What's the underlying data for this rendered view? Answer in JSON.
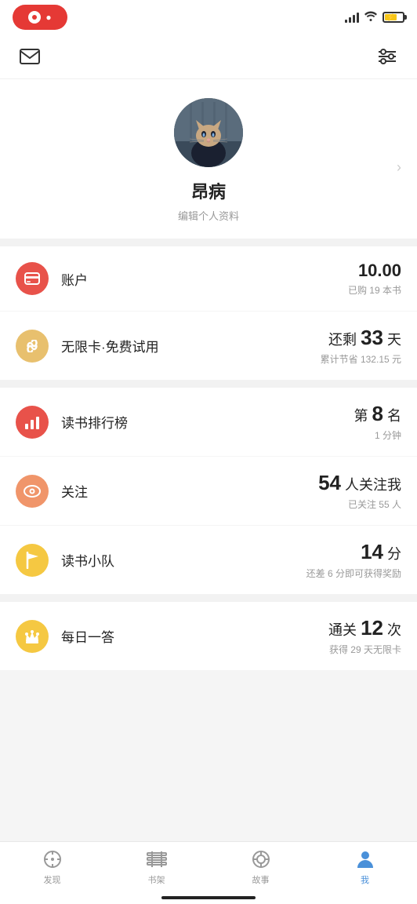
{
  "statusBar": {
    "recordLabel": "REC"
  },
  "topNav": {
    "mailIcon": "✉",
    "settingsIcon": "⚙"
  },
  "profile": {
    "username": "昂病",
    "editLabel": "编辑个人资料"
  },
  "menuItems": [
    {
      "id": "account",
      "iconBg": "#e8524a",
      "iconColor": "#fff",
      "iconSymbol": "account",
      "label": "账户",
      "mainValue": "10.00",
      "subValue": "已购 19 本书"
    },
    {
      "id": "unlimited",
      "iconBg": "#e8c06e",
      "iconColor": "#fff",
      "iconSymbol": "infinite",
      "label": "无限卡·免费试用",
      "mainPrefix": "还剩",
      "mainValue": "33",
      "mainSuffix": "天",
      "subValue": "累计节省 132.15 元"
    },
    {
      "id": "reading-rank",
      "iconBg": "#e8524a",
      "iconColor": "#fff",
      "iconSymbol": "chart",
      "label": "读书排行榜",
      "mainPrefix": "第",
      "mainValue": "8",
      "mainSuffix": "名",
      "subValue": "1 分钟"
    },
    {
      "id": "follow",
      "iconBg": "#f0956a",
      "iconColor": "#fff",
      "iconSymbol": "eye",
      "label": "关注",
      "mainValue": "54",
      "mainSuffix": "人关注我",
      "subValue": "已关注 55 人"
    },
    {
      "id": "reading-team",
      "iconBg": "#f5c842",
      "iconColor": "#fff",
      "iconSymbol": "flag",
      "label": "读书小队",
      "mainValue": "14",
      "mainSuffix": "分",
      "subValue": "还差 6 分即可获得奖励"
    },
    {
      "id": "daily-quiz",
      "iconBg": "#f5c842",
      "iconColor": "#fff",
      "iconSymbol": "crown",
      "label": "每日一答",
      "mainPrefix": "通关",
      "mainValue": "12",
      "mainSuffix": "次",
      "subValue": "获得 29 天无限卡"
    }
  ],
  "bottomNav": {
    "tabs": [
      {
        "id": "discover",
        "label": "发现",
        "icon": "compass",
        "active": false
      },
      {
        "id": "bookshelf",
        "label": "书架",
        "icon": "bookshelf",
        "active": false
      },
      {
        "id": "story",
        "label": "故事",
        "icon": "story",
        "active": false
      },
      {
        "id": "me",
        "label": "我",
        "icon": "person",
        "active": true
      }
    ]
  }
}
